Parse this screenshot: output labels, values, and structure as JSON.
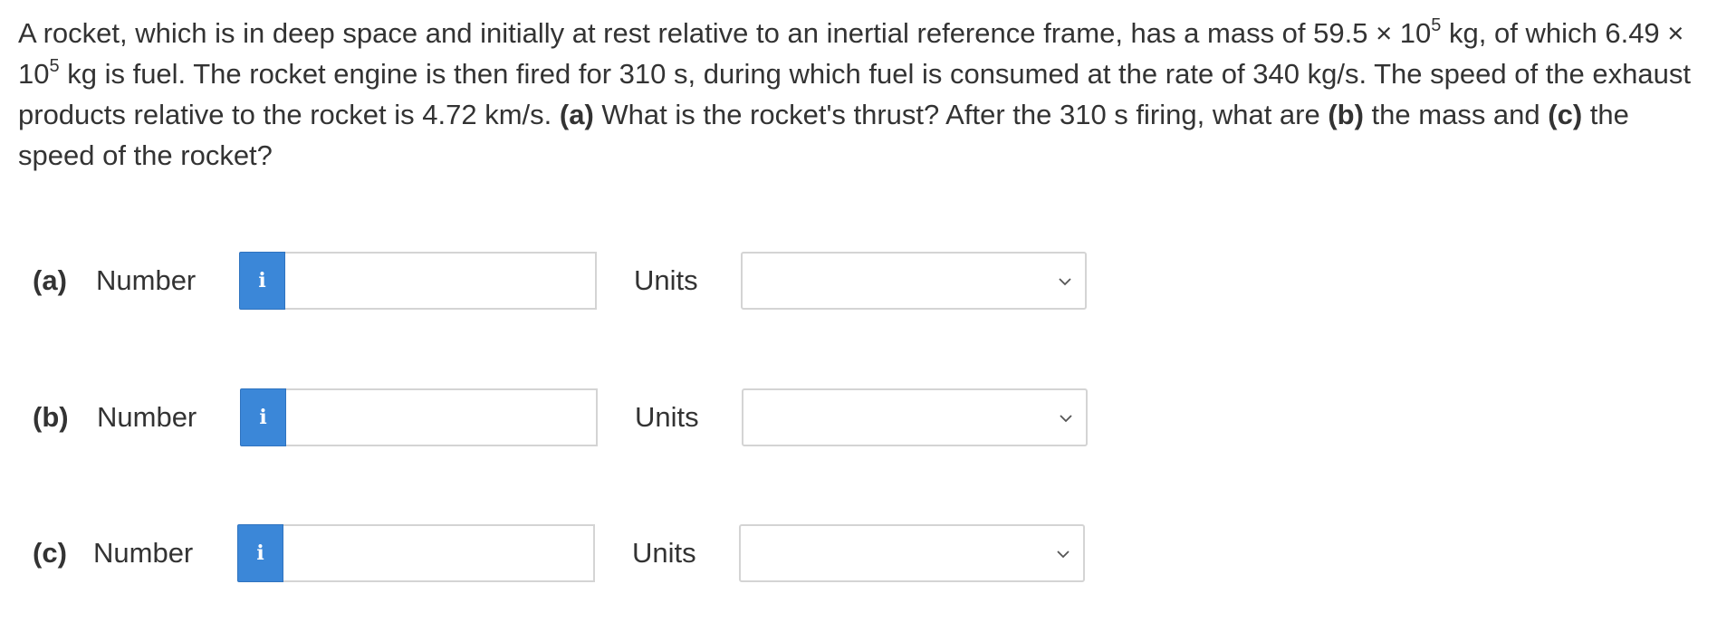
{
  "problem": {
    "t1": "A rocket, which is in deep space and initially at rest relative to an inertial reference frame, has a mass of 59.5 × 10",
    "exp1": "5",
    "t2": " kg, of which 6.49 × 10",
    "exp2": "5",
    "t3": " kg is fuel. The rocket engine is then fired for 310 s, during which fuel is consumed at the rate of 340 kg/s. The speed of the exhaust products relative to the rocket is 4.72 km/s. ",
    "a_label": "(a)",
    "t4": " What is the rocket's thrust? After the 310 s firing, what are ",
    "b_label": "(b)",
    "t5": " the mass and ",
    "c_label": "(c)",
    "t6": " the speed of the rocket?"
  },
  "parts": [
    {
      "label": "(a)",
      "number_label": "Number",
      "info_icon": "i",
      "number_value": "",
      "units_label": "Units",
      "units_selected": ""
    },
    {
      "label": "(b)",
      "number_label": "Number",
      "info_icon": "i",
      "number_value": "",
      "units_label": "Units",
      "units_selected": ""
    },
    {
      "label": "(c)",
      "number_label": "Number",
      "info_icon": "i",
      "number_value": "",
      "units_label": "Units",
      "units_selected": ""
    }
  ],
  "colors": {
    "info_button": "#3b87d8",
    "text": "#333333",
    "input_border": "#d4d4d4"
  }
}
